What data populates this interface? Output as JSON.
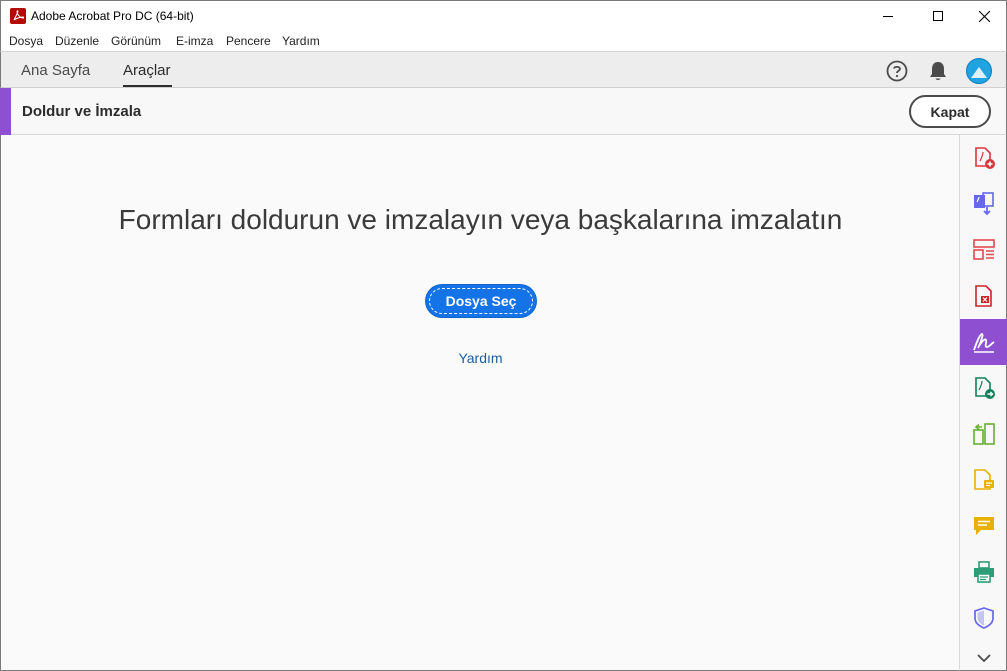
{
  "window": {
    "title": "Adobe Acrobat Pro DC (64-bit)",
    "controls": {
      "minimize": "minimize-icon",
      "maximize": "maximize-icon",
      "close": "close-icon"
    }
  },
  "menubar": {
    "items": [
      "Dosya",
      "Düzenle",
      "Görünüm",
      "E-imza",
      "Pencere",
      "Yardım"
    ]
  },
  "tabs": [
    {
      "label": "Ana Sayfa",
      "active": false
    },
    {
      "label": "Araçlar",
      "active": true
    }
  ],
  "header_icons": [
    "help-icon",
    "bell-icon",
    "user-avatar"
  ],
  "tool": {
    "title": "Doldur ve İmzala",
    "close_label": "Kapat",
    "accent_color": "#8e4fd1"
  },
  "main": {
    "headline": "Formları doldurun ve imzalayın veya başkalarına imzalatın",
    "primary_button": "Dosya Seç",
    "help_link": "Yardım",
    "button_color": "#1473e6"
  },
  "rail": {
    "items": [
      {
        "icon": "create-pdf-icon",
        "color": "#d7373f",
        "active": false
      },
      {
        "icon": "combine-files-icon",
        "color": "#6767ec",
        "active": false
      },
      {
        "icon": "organize-pages-icon",
        "color": "#e34850",
        "active": false
      },
      {
        "icon": "export-pdf-icon",
        "color": "#c9252d",
        "active": false
      },
      {
        "icon": "fill-sign-icon",
        "color": "#ffffff",
        "active": true
      },
      {
        "icon": "send-for-signature-icon",
        "color": "#12805c",
        "active": false
      },
      {
        "icon": "compare-files-icon",
        "color": "#68b030",
        "active": false
      },
      {
        "icon": "edit-pdf-icon",
        "color": "#e8b000",
        "active": false
      },
      {
        "icon": "comment-icon",
        "color": "#e8b000",
        "active": false
      },
      {
        "icon": "print-production-icon",
        "color": "#2d9d78",
        "active": false
      },
      {
        "icon": "protect-icon",
        "color": "#6767ec",
        "active": false
      },
      {
        "icon": "chevron-down-icon",
        "color": "#4b4b4b",
        "active": false
      }
    ]
  }
}
